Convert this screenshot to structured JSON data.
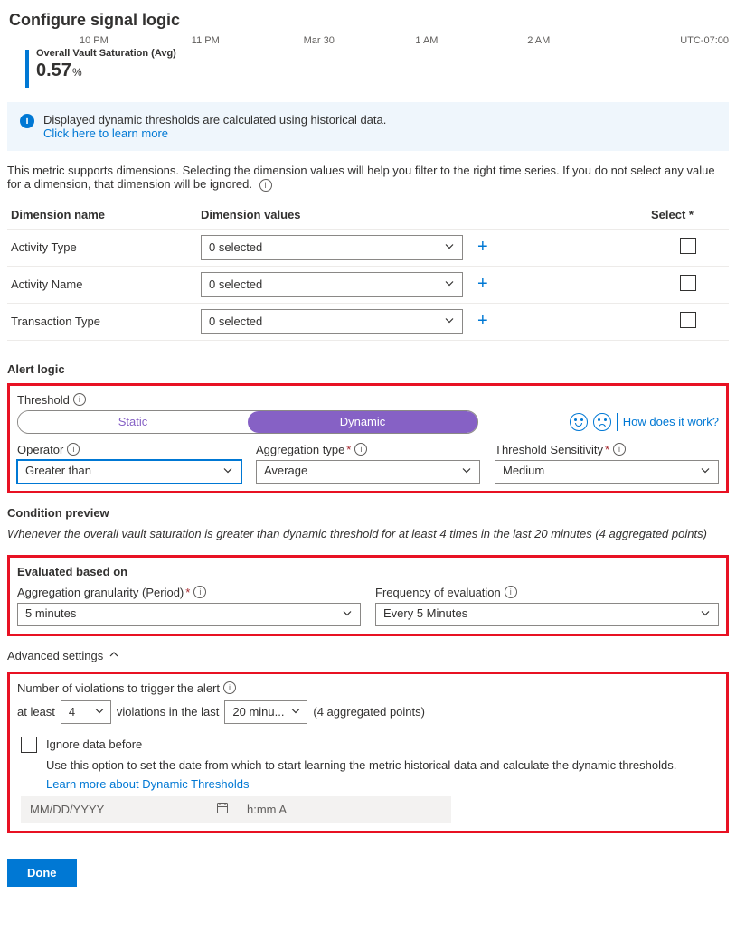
{
  "page": {
    "title": "Configure signal logic"
  },
  "time_axis": [
    "10 PM",
    "11 PM",
    "Mar 30",
    "1 AM",
    "2 AM",
    "UTC-07:00"
  ],
  "metric": {
    "label": "Overall Vault Saturation (Avg)",
    "value": "0.57",
    "unit": "%"
  },
  "info_banner": {
    "text": "Displayed dynamic thresholds are calculated using historical data.",
    "link": "Click here to learn more"
  },
  "dimensions": {
    "intro": "This metric supports dimensions. Selecting the dimension values will help you filter to the right time series. If you do not select any value for a dimension, that dimension will be ignored.",
    "headers": {
      "name": "Dimension name",
      "values": "Dimension values",
      "select": "Select *"
    },
    "rows": [
      {
        "name": "Activity Type",
        "value": "0 selected"
      },
      {
        "name": "Activity Name",
        "value": "0 selected"
      },
      {
        "name": "Transaction Type",
        "value": "0 selected"
      }
    ]
  },
  "alert_logic": {
    "title": "Alert logic",
    "threshold_label": "Threshold",
    "static": "Static",
    "dynamic": "Dynamic",
    "how_link": "How does it work?",
    "operator_label": "Operator",
    "operator_value": "Greater than",
    "agg_type_label": "Aggregation type",
    "agg_type_value": "Average",
    "sensitivity_label": "Threshold Sensitivity",
    "sensitivity_value": "Medium"
  },
  "condition": {
    "title": "Condition preview",
    "text": "Whenever the overall vault saturation is greater than dynamic threshold for at least 4 times in the last 20 minutes (4 aggregated points)"
  },
  "evaluated": {
    "title": "Evaluated based on",
    "granularity_label": "Aggregation granularity (Period)",
    "granularity_value": "5 minutes",
    "frequency_label": "Frequency of evaluation",
    "frequency_value": "Every 5 Minutes"
  },
  "advanced": {
    "toggle": "Advanced settings",
    "violations_label": "Number of violations to trigger the alert",
    "at_least": "at least",
    "count": "4",
    "in_last": "violations in the last",
    "window": "20 minu...",
    "points": "(4 aggregated points)",
    "ignore_label": "Ignore data before",
    "ignore_desc": "Use this option to set the date from which to start learning the metric historical data and calculate the dynamic thresholds.",
    "ignore_link": "Learn more about Dynamic Thresholds",
    "date_ph": "MM/DD/YYYY",
    "time_ph": "h:mm A"
  },
  "buttons": {
    "done": "Done"
  }
}
